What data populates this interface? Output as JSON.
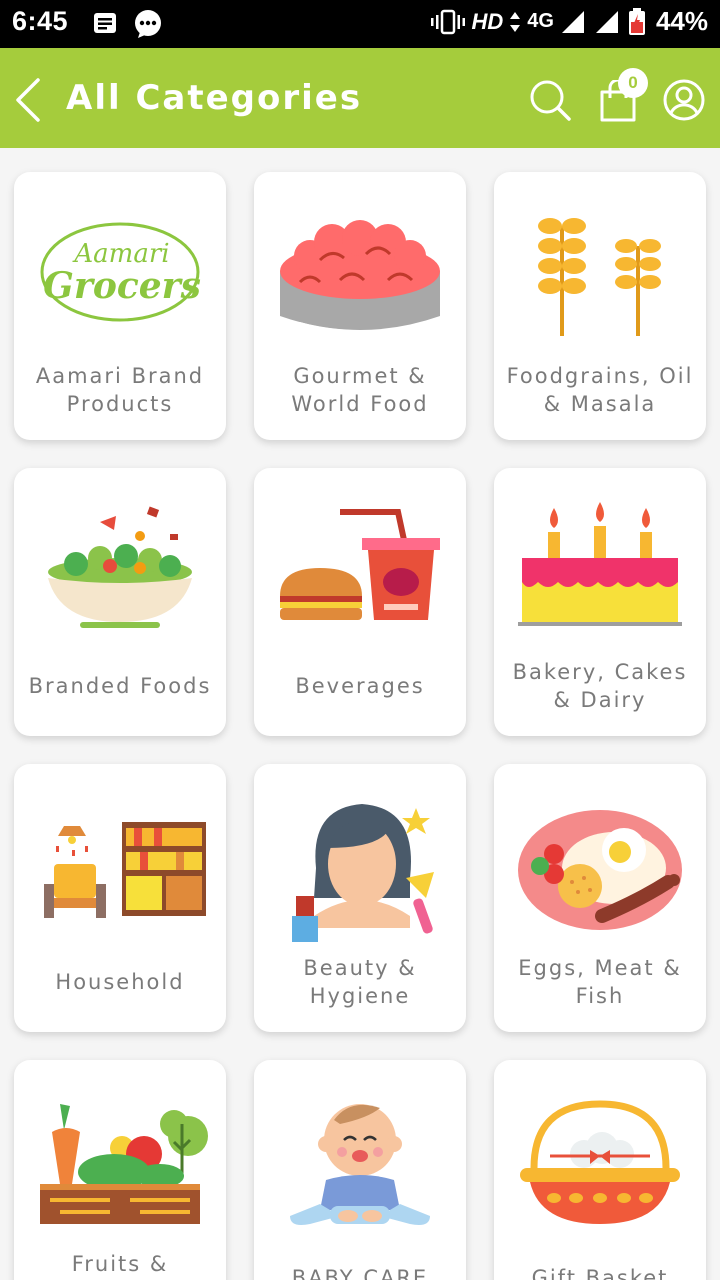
{
  "status_bar": {
    "time": "6:45",
    "network": "HD",
    "signal": "4G",
    "battery": "44%"
  },
  "header": {
    "title": "All Categories",
    "cart_count": "0",
    "icons": [
      "back-arrow-icon",
      "search-icon",
      "shopping-bag-icon",
      "user-profile-icon"
    ]
  },
  "brand_logo": {
    "line1": "Aamari",
    "line2": "Grocers"
  },
  "categories": [
    {
      "label": "Aamari Brand Products",
      "icon": "aamari-grocers-logo"
    },
    {
      "label": "Gourmet & World Food",
      "icon": "gourmet-bowl-icon"
    },
    {
      "label": "Foodgrains, Oil & Masala",
      "icon": "wheat-icon"
    },
    {
      "label": "Branded Foods",
      "icon": "salad-bowl-icon"
    },
    {
      "label": "Beverages",
      "icon": "burger-drink-icon"
    },
    {
      "label": "Bakery, Cakes & Dairy",
      "icon": "birthday-cake-icon"
    },
    {
      "label": "Household",
      "icon": "household-furniture-icon"
    },
    {
      "label": "Beauty & Hygiene",
      "icon": "beauty-woman-icon"
    },
    {
      "label": "Eggs, Meat & Fish",
      "icon": "egg-meat-plate-icon"
    },
    {
      "label": "Fruits & Vegetables",
      "icon": "vegetable-crate-icon"
    },
    {
      "label": "BABY CARE",
      "icon": "baby-icon"
    },
    {
      "label": "Gift Basket",
      "icon": "gift-basket-icon"
    }
  ],
  "colors": {
    "appbar": "#a5cc3c",
    "card": "#ffffff",
    "label": "#7a7a7a",
    "background": "#f5f5f5"
  }
}
